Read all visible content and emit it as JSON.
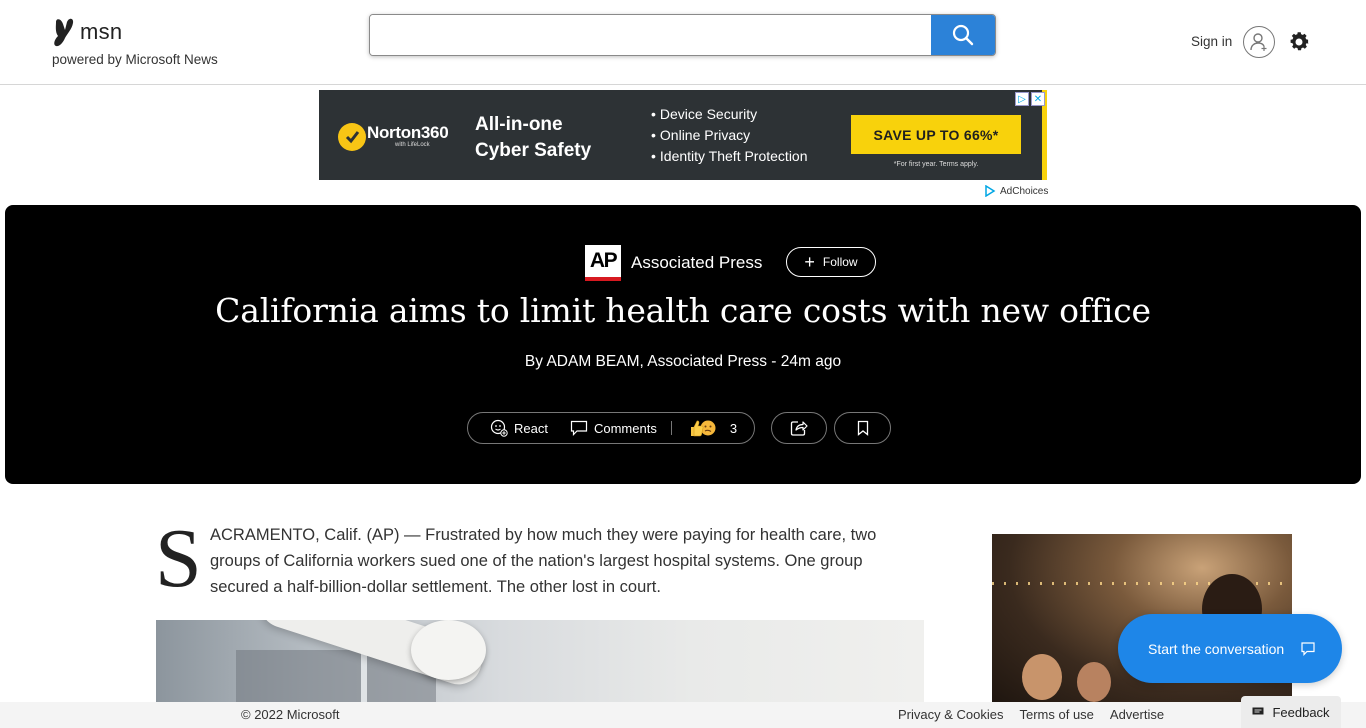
{
  "header": {
    "logo_text": "msn",
    "powered_by": "powered by Microsoft News",
    "search": {
      "value": "",
      "placeholder": ""
    },
    "signin_label": "Sign in"
  },
  "ad": {
    "brand": "Norton360",
    "brand_sub": "with LifeLock",
    "headline_line1": "All-in-one",
    "headline_line2": "Cyber Safety",
    "bullets": [
      "Device Security",
      "Online Privacy",
      "Identity Theft Protection"
    ],
    "cta": "SAVE UP TO 66%*",
    "fine_print": "*For first year. Terms apply.",
    "adchoices": "AdChoices",
    "colors": {
      "background": "#2d3235",
      "accent": "#f8d20c"
    }
  },
  "article": {
    "source_logo": "AP",
    "source_name": "Associated Press",
    "follow_label": "Follow",
    "headline": "California aims to limit health care costs with new office",
    "byline": "By ADAM BEAM, Associated Press - 24m ago",
    "actions": {
      "react_label": "React",
      "comments_label": "Comments",
      "reaction_count": "3"
    },
    "dropcap": "S",
    "lead_text": "ACRAMENTO, Calif. (AP) — Frustrated by how much they were paying for health care, two groups of California workers sued one of the nation's largest hospital systems. One group secured a half-billion-dollar settlement. The other lost in court."
  },
  "chat": {
    "label": "Start the conversation"
  },
  "footer": {
    "copyright": "© 2022 Microsoft",
    "links": [
      "Privacy & Cookies",
      "Terms of use",
      "Advertise"
    ],
    "feedback_label": "Feedback"
  },
  "colors": {
    "search_button": "#2c82d8",
    "chat_button": "#1e86e8",
    "hero_background": "#000000",
    "ap_red": "#d71920"
  }
}
